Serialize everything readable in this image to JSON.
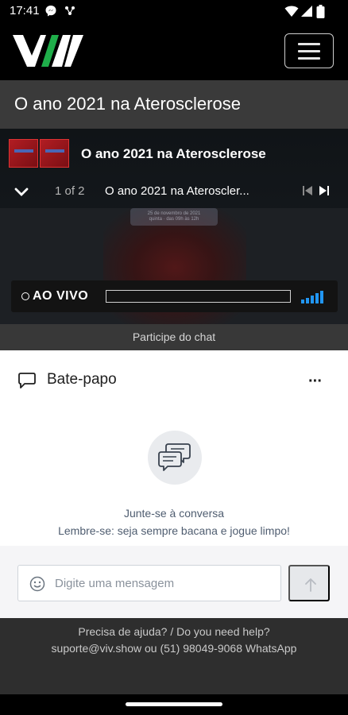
{
  "status_bar": {
    "time": "17:41",
    "icons": [
      "messenger-icon",
      "network-icon",
      "wifi-icon",
      "cell-signal-icon",
      "battery-icon"
    ]
  },
  "header": {
    "logo": "VIV",
    "logo_colors": {
      "white": "#ffffff",
      "green": "#1fae4a"
    },
    "menu_icon": "hamburger-menu-icon"
  },
  "page": {
    "title": "O ano 2021 na Aterosclerose"
  },
  "player": {
    "now_playing_title": "O ano 2021 na Aterosclerose",
    "counter": "1 of 2",
    "track_title": "O ano 2021 na Ateroscler...",
    "live_label": "AO VIVO",
    "background_slide_text": "25 de novembro de 2021",
    "background_slide_subtext": "quinta · das 09h às 12h",
    "signal_color": "#2196f3",
    "icons": {
      "collapse": "chevron-down-icon",
      "prev": "skip-previous-icon",
      "next": "skip-next-icon",
      "signal": "signal-bars-icon"
    }
  },
  "chat_link": "Participe do chat",
  "chat": {
    "title": "Bate-papo",
    "more_label": "···",
    "empty_line1": "Junte-se à conversa",
    "empty_line2": "Lembre-se: seja sempre bacana e jogue limpo!",
    "input_placeholder": "Digite uma mensagem",
    "input_value": "",
    "text_color": "#4f5d70"
  },
  "footer": {
    "line1": "Precisa de ajuda? / Do you need help?",
    "line2": "suporte@viv.show ou (51) 98049-9068 WhatsApp"
  }
}
